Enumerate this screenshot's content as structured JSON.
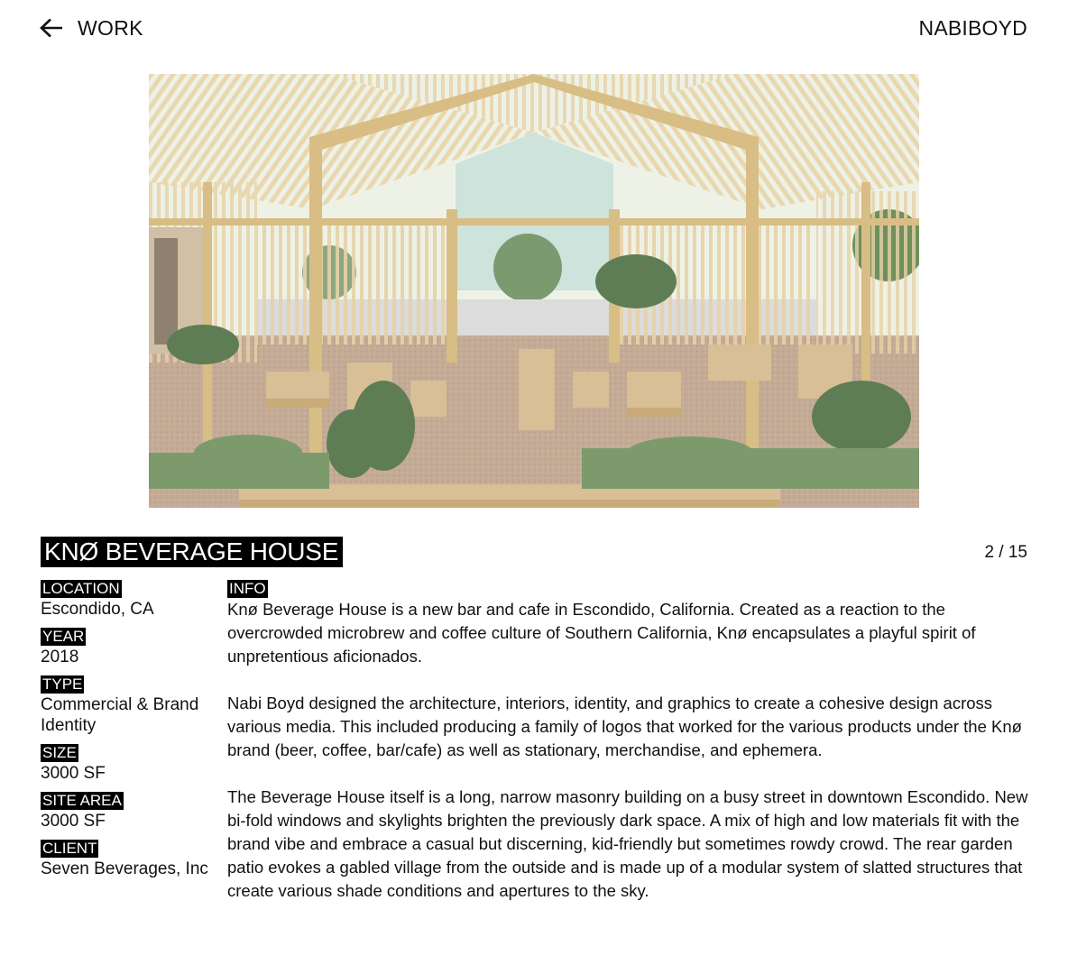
{
  "nav": {
    "back_label": "WORK",
    "brand": "NABIBOYD"
  },
  "project": {
    "title": "KNØ BEVERAGE HOUSE",
    "counter": "2 / 15",
    "meta": [
      {
        "label": "LOCATION",
        "value": "Escondido, CA"
      },
      {
        "label": "YEAR",
        "value": "2018"
      },
      {
        "label": "TYPE",
        "value": "Commercial & Brand Identity"
      },
      {
        "label": "SIZE",
        "value": "3000 SF"
      },
      {
        "label": "SITE AREA",
        "value": "3000 SF"
      },
      {
        "label": "CLIENT",
        "value": "Seven Beverages, Inc"
      }
    ],
    "info_label": "INFO",
    "info": [
      "Knø Beverage House is a new bar and cafe in Escondido, California. Created as a reaction to the overcrowded microbrew and coffee culture of Southern California, Knø encapsulates a playful spirit of unpretentious aficionados.",
      "Nabi Boyd designed the architecture, interiors, identity, and graphics to create a cohesive design across various media. This included producing a family of logos that worked for the various products under the Knø brand (beer, coffee, bar/cafe) as well as stationary, merchandise, and ephemera.",
      "The Beverage House itself is a long, narrow masonry building on a busy street in downtown Escondido. New bi-fold windows and skylights brighten the previously dark space. A mix of high and low materials fit with the brand vibe and embrace a casual but discerning, kid-friendly but sometimes rowdy crowd. The rear garden patio evokes a gabled village from the outside and is made up of a modular system of slatted structures that create various shade conditions and apertures to the sky."
    ]
  },
  "icons": {
    "back": "arrow-left-icon"
  },
  "colors": {
    "background": "#ffffff",
    "text": "#111111",
    "label_bg": "#000000",
    "label_text": "#ffffff"
  }
}
